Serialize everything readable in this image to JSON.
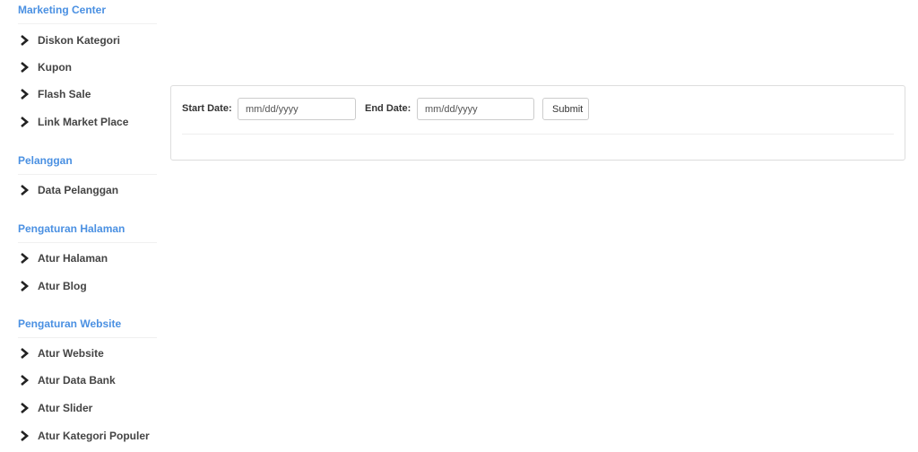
{
  "sidebar": {
    "sections": [
      {
        "title": "Marketing Center",
        "items": [
          "Diskon Kategori",
          "Kupon",
          "Flash Sale",
          "Link Market Place"
        ]
      },
      {
        "title": "Pelanggan",
        "items": [
          "Data Pelanggan"
        ]
      },
      {
        "title": "Pengaturan Halaman",
        "items": [
          "Atur Halaman",
          "Atur Blog"
        ]
      },
      {
        "title": "Pengaturan Website",
        "items": [
          "Atur Website",
          "Atur Data Bank",
          "Atur Slider",
          "Atur Kategori Populer"
        ]
      }
    ]
  },
  "filter": {
    "start_label": "Start Date:",
    "start_placeholder": "mm/dd/yyyy",
    "end_label": "End Date:",
    "end_placeholder": "mm/dd/yyyy",
    "submit_label": "Submit"
  },
  "colors": {
    "section_title": "#4a90e2",
    "nav_text": "#444444",
    "panel_border": "#dddddd"
  }
}
